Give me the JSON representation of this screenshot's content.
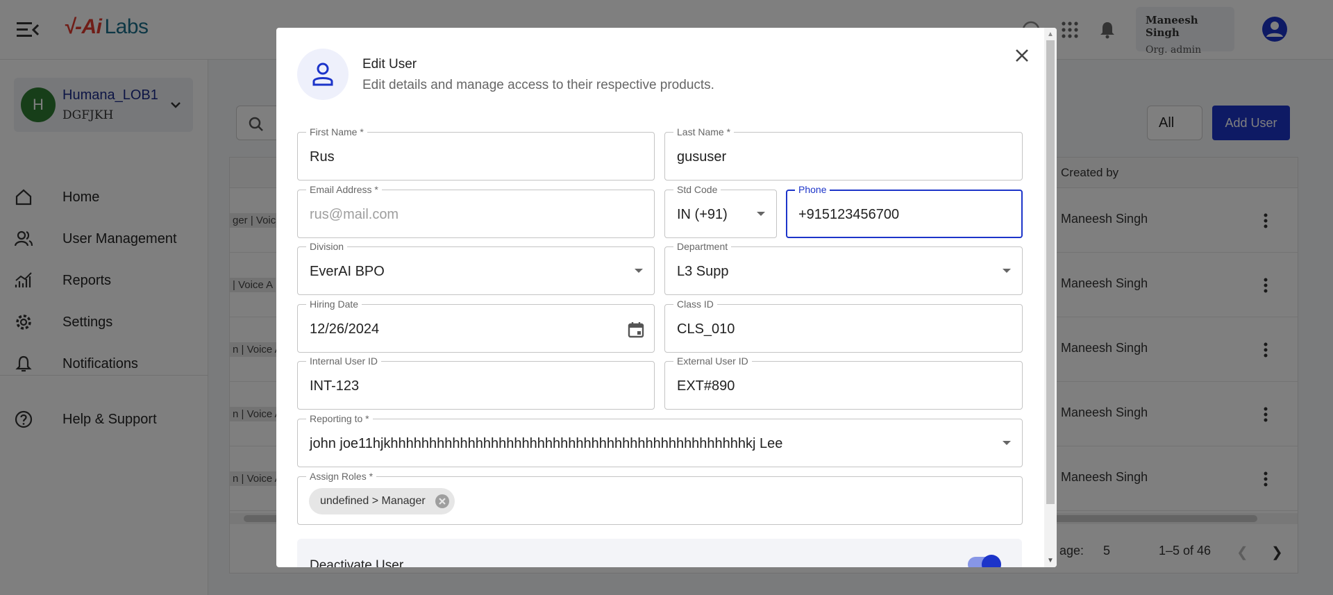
{
  "app": {
    "logo_mark": "√-Ai",
    "logo_text": "Labs",
    "user_name": "Maneesh Singh",
    "user_role": "Org. admin"
  },
  "sidebar": {
    "org_initial": "H",
    "org_name": "Humana_LOB1",
    "org_sub": "DGFJKH",
    "items": [
      {
        "label": "Home",
        "icon": "home-icon"
      },
      {
        "label": "User Management",
        "icon": "users-icon"
      },
      {
        "label": "Reports",
        "icon": "chart-icon"
      },
      {
        "label": "Settings",
        "icon": "gear-icon"
      },
      {
        "label": "Notifications",
        "icon": "bell-icon"
      },
      {
        "label": "Help & Support",
        "icon": "help-icon"
      }
    ]
  },
  "background_table": {
    "filter_value": "All",
    "add_user_label": "Add User",
    "created_by_header": "Created by",
    "rows": [
      {
        "role_snippet": "ger | Voic",
        "created_by": "Maneesh Singh"
      },
      {
        "role_snippet": " | Voice A",
        "created_by": "Maneesh Singh"
      },
      {
        "role_snippet": "n | Voice A",
        "created_by": "Maneesh Singh"
      },
      {
        "role_snippet": "n | Voice A",
        "created_by": "Maneesh Singh"
      },
      {
        "role_snippet": "n | Voice A",
        "created_by": "Maneesh Singh"
      }
    ],
    "rows_per_page_label": "age:",
    "rows_per_page": "5",
    "range": "1–5 of 46"
  },
  "modal": {
    "title": "Edit User",
    "subtitle": "Edit details and manage access to their respective products.",
    "fields": {
      "first_name": {
        "label": "First Name *",
        "value": "Rus"
      },
      "last_name": {
        "label": "Last Name *",
        "value": "gususer"
      },
      "email": {
        "label": "Email Address *",
        "value": "rus@mail.com"
      },
      "std_code": {
        "label": "Std Code",
        "value": "IN (+91)"
      },
      "phone": {
        "label": "Phone",
        "value": "+915123456700"
      },
      "division": {
        "label": "Division",
        "value": "EverAI BPO"
      },
      "department": {
        "label": "Department",
        "value": "L3 Supp"
      },
      "hiring_date": {
        "label": "Hiring Date",
        "value": "12/26/2024"
      },
      "class_id": {
        "label": "Class ID",
        "value": "CLS_010"
      },
      "internal_user_id": {
        "label": "Internal User ID",
        "value": "INT-123"
      },
      "external_user_id": {
        "label": "External User ID",
        "value": "EXT#890"
      },
      "reporting_to": {
        "label": "Reporting to *",
        "value": "john joe11hjkhhhhhhhhhhhhhhhhhhhhhhhhhhhhhhhhhhhhhhhhhhhhhhkj Lee"
      },
      "assign_roles": {
        "label": "Assign Roles *",
        "chip": "undefined > Manager"
      }
    },
    "deactivate_label": "Deactivate User",
    "deactivate_on": true
  }
}
